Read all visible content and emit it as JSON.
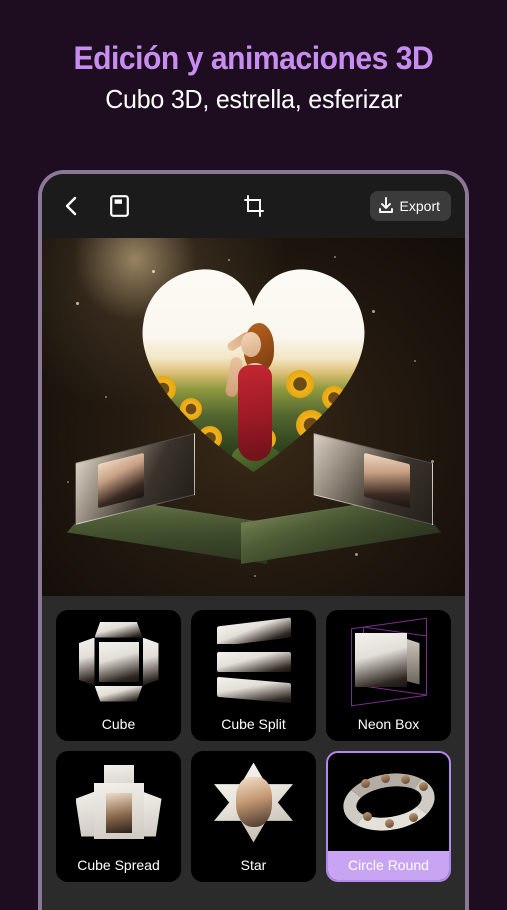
{
  "promo": {
    "title": "Edición y animaciones 3D",
    "subtitle": "Cubo 3D, estrella, esferizar",
    "title_color": "#c88df0",
    "subtitle_color": "#ffffff",
    "background_color": "#1e0d21"
  },
  "app": {
    "toolbar": {
      "back_icon": "chevron-left-icon",
      "book_icon": "book-icon",
      "crop_icon": "crop-icon",
      "export_label": "Export",
      "export_icon": "download-icon"
    },
    "preview": {
      "effect_name": "Circle Round",
      "description": "3D pop-up heart photo card with woman in red dress in a sunflower field"
    },
    "effects": {
      "selected": "Circle Round",
      "selected_border_color": "#b389ec",
      "selected_label_bg": "#c9a4f2",
      "items": [
        {
          "label": "Cube",
          "icon": "cube-unfold-icon",
          "selected": false
        },
        {
          "label": "Cube Split",
          "icon": "cube-split-icon",
          "selected": false
        },
        {
          "label": "Neon Box",
          "icon": "neon-box-icon",
          "selected": false
        },
        {
          "label": "Cube Spread",
          "icon": "cube-spread-icon",
          "selected": false
        },
        {
          "label": "Star",
          "icon": "star-icon",
          "selected": false
        },
        {
          "label": "Circle Round",
          "icon": "circle-round-icon",
          "selected": true
        }
      ]
    }
  }
}
